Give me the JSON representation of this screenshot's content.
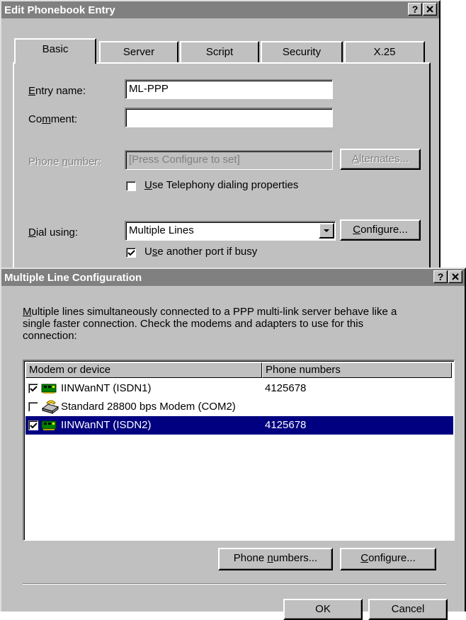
{
  "edit_dialog": {
    "title": "Edit Phonebook Entry",
    "help_button": "?",
    "close_button": "✕",
    "tabs": [
      {
        "label": "Basic"
      },
      {
        "label": "Server"
      },
      {
        "label": "Script"
      },
      {
        "label": "Security"
      },
      {
        "label": "X.25"
      }
    ],
    "entry_name_label": {
      "pre": "",
      "ul": "E",
      "post": "ntry name:"
    },
    "entry_name_value": "ML-PPP",
    "comment_label": {
      "pre": "Co",
      "ul": "m",
      "post": "ment:"
    },
    "comment_value": "",
    "phone_label": {
      "pre": "Phone ",
      "ul": "n",
      "post": "umber:"
    },
    "phone_value": "[Press Configure to set]",
    "alternates_button": {
      "pre": "",
      "ul": "A",
      "post": "lternates..."
    },
    "telephony_checkbox": {
      "pre": "",
      "ul": "U",
      "post": "se Telephony dialing properties",
      "checked": false
    },
    "dial_using_label": {
      "pre": "",
      "ul": "D",
      "post": "ial using:"
    },
    "dial_using_value": "Multiple Lines",
    "configure_button": {
      "pre": "",
      "ul": "C",
      "post": "onfigure..."
    },
    "another_port_checkbox": {
      "pre": "U",
      "ul": "s",
      "post": "e another port if busy",
      "checked": true
    }
  },
  "multi_dialog": {
    "title": "Multiple Line Configuration",
    "help_button": "?",
    "close_button": "✕",
    "description": {
      "ul": "M",
      "line1": "ultiple lines simultaneously connected to a PPP multi-link server behave like a",
      "line2": "single faster connection.  Check the modems and adapters to use for this",
      "line3": "connection:"
    },
    "columns": [
      "Modem or device",
      "Phone numbers"
    ],
    "devices": [
      {
        "name": "IINWanNT (ISDN1)",
        "phone": "4125678",
        "checked": true,
        "selected": false,
        "icon": "isdn-card-icon"
      },
      {
        "name": "Standard 28800 bps Modem (COM2)",
        "phone": "",
        "checked": false,
        "selected": false,
        "icon": "modem-icon"
      },
      {
        "name": "IINWanNT (ISDN2)",
        "phone": "4125678",
        "checked": true,
        "selected": true,
        "icon": "isdn-card-icon"
      }
    ],
    "phone_numbers_button": {
      "pre": "Phone ",
      "ul": "n",
      "post": "umbers..."
    },
    "configure_button": {
      "pre": "",
      "ul": "C",
      "post": "onfigure..."
    },
    "ok_button": "OK",
    "cancel_button": "Cancel"
  },
  "colors": {
    "title_inactive": "#808080",
    "face": "#c0c0c0",
    "selection": "#000080"
  }
}
